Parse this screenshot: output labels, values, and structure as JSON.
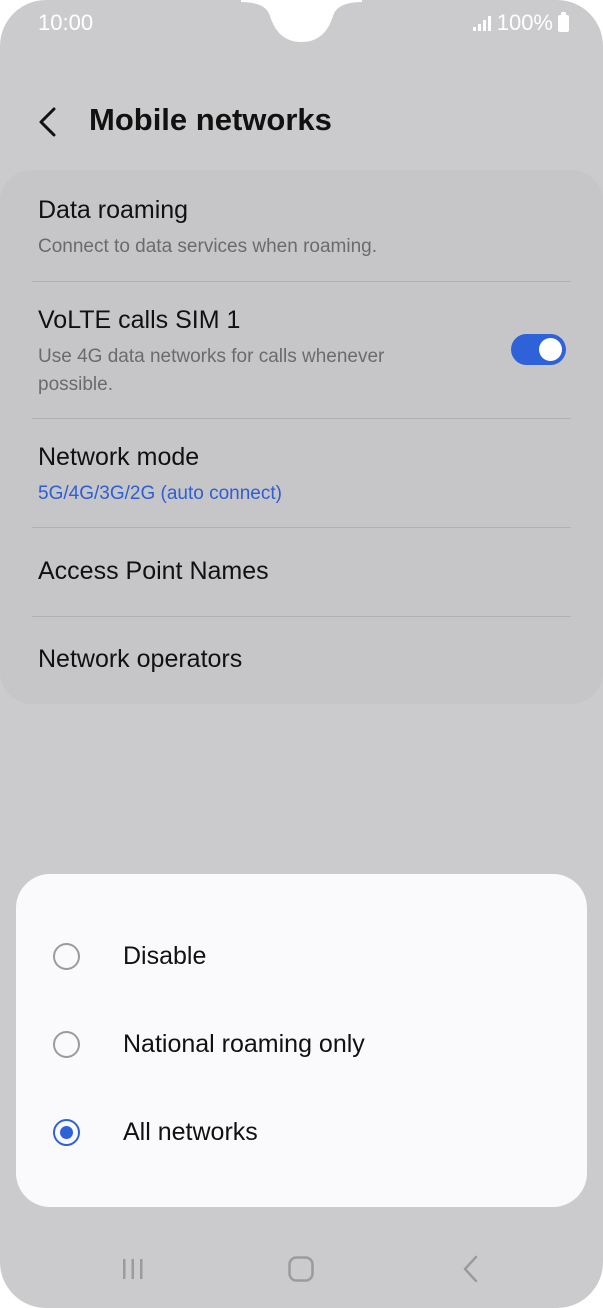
{
  "status_bar": {
    "time": "10:00",
    "battery": "100%"
  },
  "header": {
    "title": "Mobile networks"
  },
  "settings": {
    "data_roaming": {
      "title": "Data roaming",
      "subtitle": "Connect to data services when roaming."
    },
    "volte": {
      "title": "VoLTE calls SIM 1",
      "subtitle": "Use 4G data networks for calls whenever possible.",
      "enabled": true
    },
    "network_mode": {
      "title": "Network mode",
      "value": "5G/4G/3G/2G (auto connect)"
    },
    "apn": {
      "title": "Access Point Names"
    },
    "operators": {
      "title": "Network operators"
    }
  },
  "roaming_dialog": {
    "options": [
      {
        "label": "Disable",
        "selected": false
      },
      {
        "label": "National roaming only",
        "selected": false
      },
      {
        "label": "All networks",
        "selected": true
      }
    ]
  },
  "colors": {
    "accent": "#2f62d8",
    "background": "#cbcbcd",
    "sheet": "#fafafc"
  },
  "icons": [
    "back-arrow-icon",
    "signal-icon",
    "battery-icon",
    "recents-icon",
    "home-icon",
    "nav-back-icon"
  ]
}
